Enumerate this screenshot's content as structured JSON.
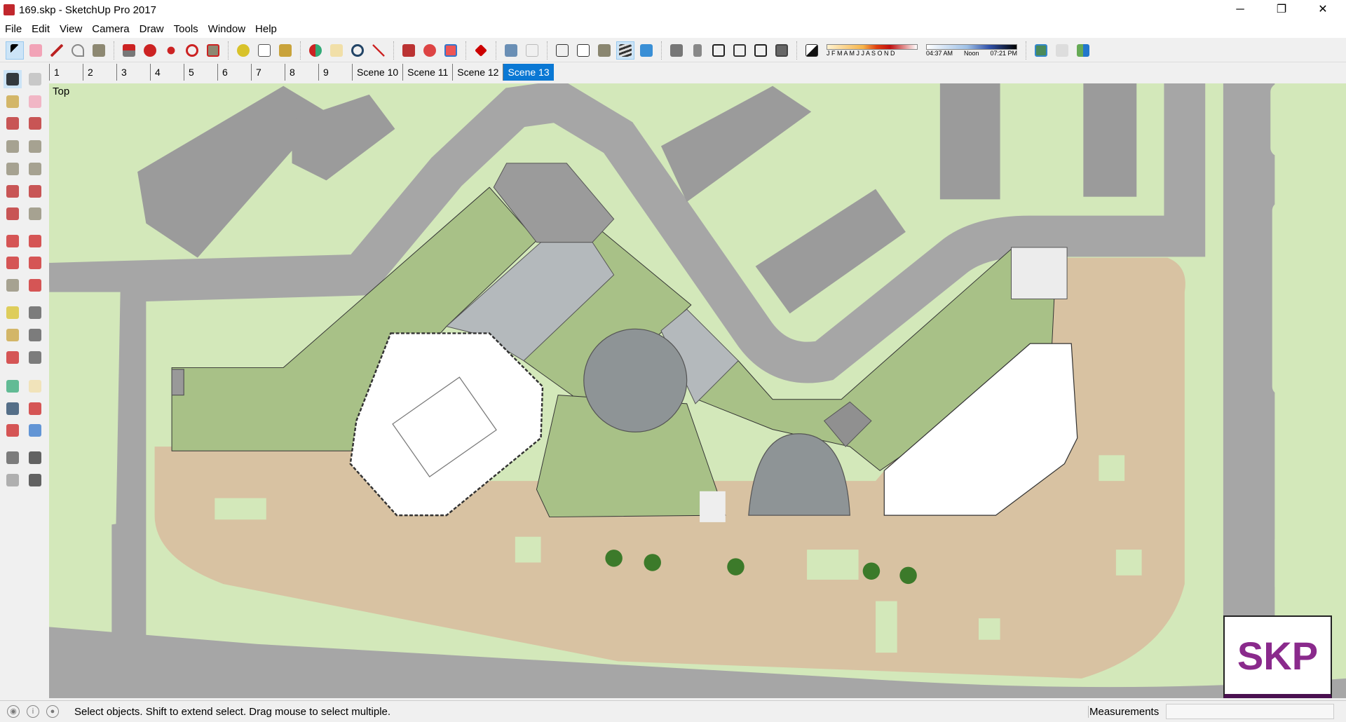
{
  "window": {
    "title": "169.skp - SketchUp Pro 2017",
    "minimize": "─",
    "maximize": "❐",
    "close": "✕"
  },
  "menu": [
    "File",
    "Edit",
    "View",
    "Camera",
    "Draw",
    "Tools",
    "Window",
    "Help"
  ],
  "toolbar": {
    "icons": [
      "select",
      "eraser",
      "pencil",
      "arc",
      "rectangle",
      "push-pull",
      "follow-me",
      "move",
      "rotate",
      "scale",
      "tape-measure",
      "text",
      "paint-bucket",
      "orbit",
      "pan",
      "zoom",
      "zoom-extents",
      "warehouse-3d",
      "extension-warehouse",
      "layout",
      "extension-manager",
      "xray",
      "back-edges",
      "wireframe",
      "hidden-line",
      "shaded",
      "shaded-with-textures",
      "monochrome",
      "iso",
      "top",
      "front",
      "right",
      "back",
      "left",
      "shadows"
    ],
    "shadow_months": "J F M A M J J A S O N D",
    "time_start": "04:37 AM",
    "time_mid": "Noon",
    "time_end": "07:21 PM"
  },
  "scenes": [
    "1",
    "2",
    "3",
    "4",
    "5",
    "6",
    "7",
    "8",
    "9",
    "Scene 10",
    "Scene 11",
    "Scene 12",
    "Scene 13"
  ],
  "active_scene": "Scene 13",
  "viewport": {
    "view_label": "Top",
    "logo_text": "SKP"
  },
  "statusbar": {
    "text": "Select objects. Shift to extend select. Drag mouse to select multiple.",
    "measurements_label": "Measurements",
    "measurements_value": ""
  },
  "colors": {
    "accent": "#0a78d4",
    "lawn": "#d3e8ba",
    "road": "#a6a6a6",
    "roof_green": "#a8c187",
    "paving": "#d8c2a2",
    "building_gray": "#9b9b9b"
  }
}
